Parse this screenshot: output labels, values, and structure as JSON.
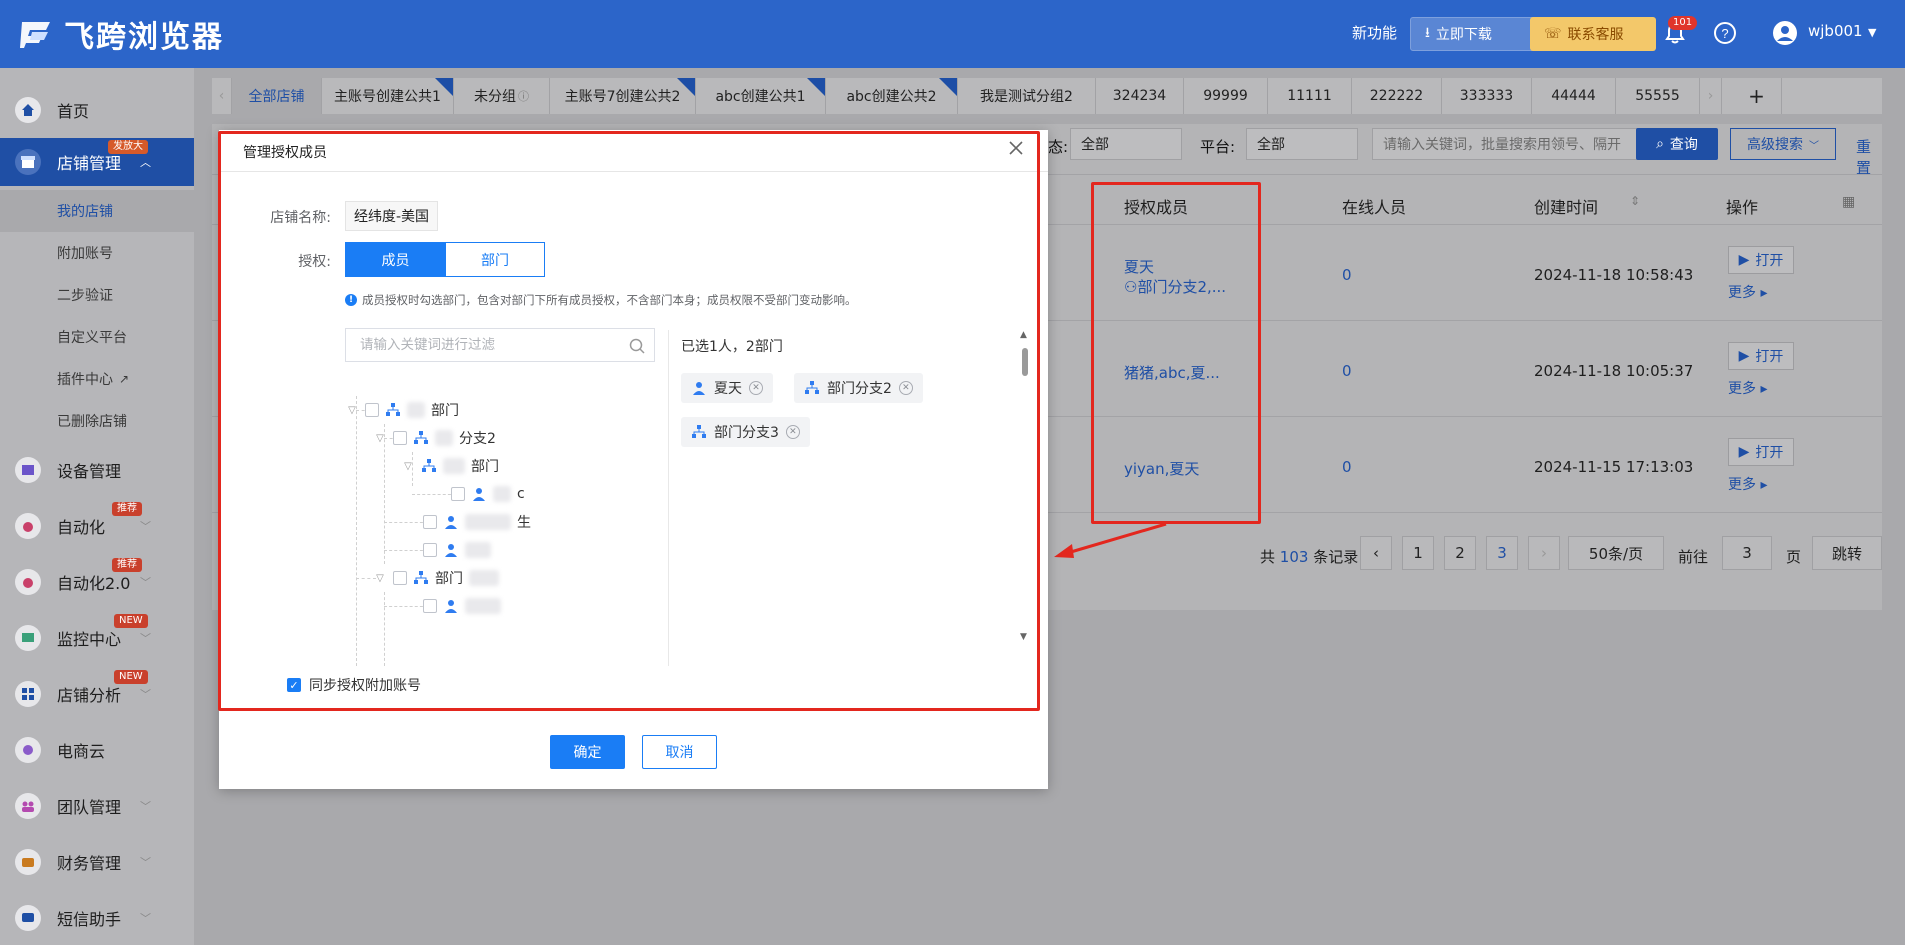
{
  "header": {
    "brand": "飞跨浏览器",
    "new_feature": "新功能",
    "download_label": "立即下载",
    "service_label": "联系客服",
    "notification_count": "101",
    "username": "wjb001"
  },
  "sidebar": {
    "items": [
      {
        "label": "首页"
      },
      {
        "label": "店铺管理",
        "tag": "发放大"
      },
      {
        "label": "设备管理"
      },
      {
        "label": "自动化",
        "tag": "推荐"
      },
      {
        "label": "自动化2.0",
        "tag": "推荐"
      },
      {
        "label": "监控中心",
        "tag": "NEW"
      },
      {
        "label": "店铺分析",
        "tag": "NEW"
      },
      {
        "label": "电商云"
      },
      {
        "label": "团队管理"
      },
      {
        "label": "财务管理"
      },
      {
        "label": "短信助手"
      }
    ],
    "sub_items": [
      {
        "label": "我的店铺"
      },
      {
        "label": "附加账号"
      },
      {
        "label": "二步验证"
      },
      {
        "label": "自定义平台"
      },
      {
        "label": "插件中心"
      },
      {
        "label": "已删除店铺"
      }
    ]
  },
  "tabs": [
    {
      "label": "全部店铺"
    },
    {
      "label": "主账号创建公共1"
    },
    {
      "label": "未分组"
    },
    {
      "label": "主账号7创建公共2"
    },
    {
      "label": "abc创建公共1"
    },
    {
      "label": "abc创建公共2"
    },
    {
      "label": "我是测试分组2"
    },
    {
      "label": "324234"
    },
    {
      "label": "99999"
    },
    {
      "label": "11111"
    },
    {
      "label": "222222"
    },
    {
      "label": "333333"
    },
    {
      "label": "44444"
    },
    {
      "label": "55555"
    }
  ],
  "filters": {
    "status_label": "态:",
    "status_value": "全部",
    "platform_label": "平台:",
    "platform_value": "全部",
    "search_placeholder": "请输入关键词，批量搜索用领号、隔开",
    "query_label": "查询",
    "advanced_label": "高级搜索",
    "reset_label": "重置"
  },
  "table": {
    "headers": {
      "members": "授权成员",
      "online": "在线人员",
      "created": "创建时间",
      "actions": "操作"
    },
    "rows": [
      {
        "members_line1": "夏天",
        "members_line2": "部门分支2,...",
        "online": "0",
        "created": "2024-11-18 10:58:43",
        "open": "打开",
        "more": "更多"
      },
      {
        "members_line1": "猪猪,abc,夏...",
        "members_line2": "",
        "online": "0",
        "created": "2024-11-18 10:05:37",
        "open": "打开",
        "more": "更多"
      },
      {
        "members_line1": "yiyan,夏天",
        "members_line2": "",
        "online": "0",
        "created": "2024-11-15 17:13:03",
        "open": "打开",
        "more": "更多"
      }
    ]
  },
  "pagination": {
    "total_prefix": "共",
    "total": "103",
    "total_suffix": "条记录",
    "pages": [
      "1",
      "2",
      "3"
    ],
    "page_size": "50条/页",
    "goto_prefix": "前往",
    "goto_value": "3",
    "goto_suffix": "页",
    "jump": "跳转"
  },
  "modal": {
    "title": "管理授权成员",
    "store_label": "店铺名称:",
    "store_name": "经纬度-美国",
    "auth_label": "授权:",
    "seg_member": "成员",
    "seg_dept": "部门",
    "hint": "成员授权时勾选部门，包含对部门下所有成员授权，不含部门本身；成员权限不受部门变动影响。",
    "filter_placeholder": "请输入关键词进行过滤",
    "tree": [
      {
        "label": "部门"
      },
      {
        "label": "分支2"
      },
      {
        "label": "部门"
      },
      {
        "label": "c"
      },
      {
        "label": "生"
      },
      {
        "label": ""
      },
      {
        "label": "部门"
      },
      {
        "label": ""
      }
    ],
    "selected_summary": "已选1人，2部门",
    "chips": [
      {
        "label": "夏天",
        "type": "user"
      },
      {
        "label": "部门分支2",
        "type": "dept"
      },
      {
        "label": "部门分支3",
        "type": "dept"
      }
    ],
    "sync_label": "同步授权附加账号",
    "ok_label": "确定",
    "cancel_label": "取消"
  }
}
